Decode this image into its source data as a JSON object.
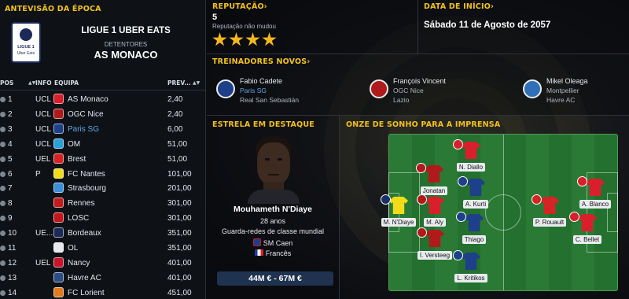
{
  "left": {
    "title": "ANTEVISÃO DA ÉPOCA",
    "league_name": "LIGUE 1 UBER EATS",
    "holders_label": "DETENTORES",
    "holders_team": "AS MONACO",
    "logo_text_top": "LIGUE 1",
    "logo_text_bottom": "Uber Eats",
    "table_headers": {
      "pos": "POS",
      "info": "INFO",
      "team": "EQUIPA",
      "prev": "PREV..."
    },
    "rows": [
      {
        "pos": "1",
        "info": "UCL",
        "team": "AS Monaco",
        "prev": "2,40",
        "color": "#d91f2b"
      },
      {
        "pos": "2",
        "info": "UCL",
        "team": "OGC Nice",
        "prev": "2,40",
        "color": "#b01a1a"
      },
      {
        "pos": "3",
        "info": "UCL",
        "team": "Paris SG",
        "prev": "6,00",
        "color": "#1e3f8a",
        "link": true
      },
      {
        "pos": "4",
        "info": "UCL",
        "team": "OM",
        "prev": "51,00",
        "color": "#2aa0d8"
      },
      {
        "pos": "5",
        "info": "UEL",
        "team": "Brest",
        "prev": "51,00",
        "color": "#d62424"
      },
      {
        "pos": "6",
        "info": "P",
        "team": "FC Nantes",
        "prev": "101,00",
        "color": "#f2dc1a"
      },
      {
        "pos": "7",
        "info": "",
        "team": "Strasbourg",
        "prev": "201,00",
        "color": "#3a8fd6"
      },
      {
        "pos": "8",
        "info": "",
        "team": "Rennes",
        "prev": "301,00",
        "color": "#c21c1c"
      },
      {
        "pos": "9",
        "info": "",
        "team": "LOSC",
        "prev": "301,00",
        "color": "#c4161c"
      },
      {
        "pos": "10",
        "info": "UE...",
        "team": "Bordeaux",
        "prev": "351,00",
        "color": "#1b2a56"
      },
      {
        "pos": "11",
        "info": "",
        "team": "OL",
        "prev": "351,00",
        "color": "#e8e8ee"
      },
      {
        "pos": "12",
        "info": "UEL",
        "team": "Nancy",
        "prev": "401,00",
        "color": "#c8142c"
      },
      {
        "pos": "13",
        "info": "",
        "team": "Havre AC",
        "prev": "401,00",
        "color": "#2b4d83"
      },
      {
        "pos": "14",
        "info": "",
        "team": "FC Lorient",
        "prev": "451,00",
        "color": "#e27a1e"
      }
    ]
  },
  "reputation": {
    "title": "REPUTAÇÃO",
    "value": "5",
    "subtitle": "Reputação não mudou",
    "stars": 4
  },
  "start_date": {
    "title": "DATA DE INÍCIO",
    "value": "Sábado 11 de Agosto de 2057"
  },
  "new_managers": {
    "title": "TREINADORES NOVOS",
    "items": [
      {
        "name": "Fabio Cadete",
        "club": "Paris SG",
        "from": "Real San Sebastián",
        "color": "#1e3f8a",
        "link": true
      },
      {
        "name": "François Vincent",
        "club": "OGC Nice",
        "from": "Lazio",
        "color": "#b01a1a",
        "link": false
      },
      {
        "name": "Mikel Oleaga",
        "club": "Montpellier",
        "from": "Havre AC",
        "color": "#2f6fb8",
        "link": false
      }
    ]
  },
  "star_player": {
    "title": "ESTRELA EM DESTAQUE",
    "name": "Mouhameth N'Diaye",
    "age": "28 anos",
    "role": "Guarda-redes de classe mundial",
    "club": "SM Caen",
    "nationality": "Francês",
    "value": "44M € - 67M €"
  },
  "dream_team": {
    "title": "ONZE DE SONHO PARA A IMPRENSA",
    "players": [
      {
        "name": "M. N'Diaye",
        "shirt": "#f2dc1a",
        "crest": "#1b2f6b"
      },
      {
        "name": "N. Diallo",
        "shirt": "#d91f2b",
        "crest": "#d91f2b"
      },
      {
        "name": "Jonatan",
        "shirt": "#b01a1a",
        "crest": "#b01a1a"
      },
      {
        "name": "A. Kurti",
        "shirt": "#1e3f8a",
        "crest": "#1e3f8a"
      },
      {
        "name": "M. Aly",
        "shirt": "#d91f2b",
        "crest": "#b01a1a"
      },
      {
        "name": "Thiago",
        "shirt": "#1e3f8a",
        "crest": "#1e3f8a"
      },
      {
        "name": "I. Versteeg",
        "shirt": "#b01a1a",
        "crest": "#b01a1a"
      },
      {
        "name": "L. Kritikos",
        "shirt": "#1e3f8a",
        "crest": "#1e3f8a"
      },
      {
        "name": "P. Rouault",
        "shirt": "#d62424",
        "crest": "#d62424"
      },
      {
        "name": "A. Blanco",
        "shirt": "#d91f2b",
        "crest": "#d91f2b"
      },
      {
        "name": "C. Bellet",
        "shirt": "#d91f2b",
        "crest": "#d91f2b"
      }
    ]
  }
}
